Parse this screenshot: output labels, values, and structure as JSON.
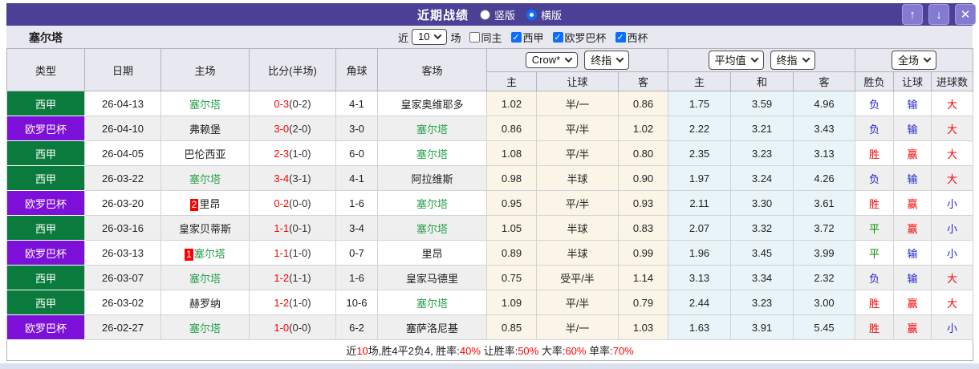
{
  "header": {
    "title": "近期战绩",
    "layout_vertical": "竖版",
    "layout_horizontal": "横版",
    "up_icon": "↑",
    "down_icon": "↓",
    "close_icon": "✕"
  },
  "filter": {
    "team": "塞尔塔",
    "near_label": "近",
    "count_value": "10",
    "games_label": "场",
    "same_home_label": "同主",
    "leagues": [
      "西甲",
      "欧罗巴杯",
      "西杯"
    ]
  },
  "table": {
    "columns": [
      "类型",
      "日期",
      "主场",
      "比分(半场)",
      "角球",
      "客场"
    ],
    "selects": {
      "company": "Crow*",
      "final1": "终指",
      "average": "平均值",
      "final2": "终指",
      "full": "全场"
    },
    "sub_headers": [
      "主",
      "让球",
      "客",
      "主",
      "和",
      "客",
      "胜负",
      "让球",
      "进球数"
    ],
    "rows": [
      {
        "league": "西甲",
        "league_color": "green",
        "date": "26-04-13",
        "home_rank": "",
        "home": "塞尔塔",
        "home_celta": true,
        "score": "0-3",
        "half": "(0-2)",
        "corner": "4-1",
        "away": "皇家奥维耶多",
        "away_celta": false,
        "crow": [
          "1.02",
          "半/一",
          "0.86"
        ],
        "avg": [
          "1.75",
          "3.59",
          "4.96"
        ],
        "results": [
          {
            "t": "负",
            "c": "blue"
          },
          {
            "t": "输",
            "c": "blue"
          },
          {
            "t": "大",
            "c": "red"
          }
        ]
      },
      {
        "league": "欧罗巴杯",
        "league_color": "purple",
        "date": "26-04-10",
        "home_rank": "",
        "home": "弗赖堡",
        "home_celta": false,
        "score": "3-0",
        "half": "(2-0)",
        "corner": "3-0",
        "away": "塞尔塔",
        "away_celta": true,
        "crow": [
          "0.86",
          "平/半",
          "1.02"
        ],
        "avg": [
          "2.22",
          "3.21",
          "3.43"
        ],
        "results": [
          {
            "t": "负",
            "c": "blue"
          },
          {
            "t": "输",
            "c": "blue"
          },
          {
            "t": "大",
            "c": "red"
          }
        ]
      },
      {
        "league": "西甲",
        "league_color": "green",
        "date": "26-04-05",
        "home_rank": "",
        "home": "巴伦西亚",
        "home_celta": false,
        "score": "2-3",
        "half": "(1-0)",
        "corner": "6-0",
        "away": "塞尔塔",
        "away_celta": true,
        "crow": [
          "1.08",
          "平/半",
          "0.80"
        ],
        "avg": [
          "2.35",
          "3.23",
          "3.13"
        ],
        "results": [
          {
            "t": "胜",
            "c": "red"
          },
          {
            "t": "赢",
            "c": "red"
          },
          {
            "t": "大",
            "c": "red"
          }
        ]
      },
      {
        "league": "西甲",
        "league_color": "green",
        "date": "26-03-22",
        "home_rank": "",
        "home": "塞尔塔",
        "home_celta": true,
        "score": "3-4",
        "half": "(3-1)",
        "corner": "4-1",
        "away": "阿拉维斯",
        "away_celta": false,
        "crow": [
          "0.98",
          "半球",
          "0.90"
        ],
        "avg": [
          "1.97",
          "3.24",
          "4.26"
        ],
        "results": [
          {
            "t": "负",
            "c": "blue"
          },
          {
            "t": "输",
            "c": "blue"
          },
          {
            "t": "大",
            "c": "red"
          }
        ]
      },
      {
        "league": "欧罗巴杯",
        "league_color": "purple",
        "date": "26-03-20",
        "home_rank": "2",
        "home": "里昂",
        "home_celta": false,
        "score": "0-2",
        "half": "(0-0)",
        "corner": "1-6",
        "away": "塞尔塔",
        "away_celta": true,
        "crow": [
          "0.95",
          "平/半",
          "0.93"
        ],
        "avg": [
          "2.11",
          "3.30",
          "3.61"
        ],
        "results": [
          {
            "t": "胜",
            "c": "red"
          },
          {
            "t": "赢",
            "c": "red"
          },
          {
            "t": "小",
            "c": "blue"
          }
        ]
      },
      {
        "league": "西甲",
        "league_color": "green",
        "date": "26-03-16",
        "home_rank": "",
        "home": "皇家贝蒂斯",
        "home_celta": false,
        "score": "1-1",
        "half": "(0-1)",
        "corner": "3-4",
        "away": "塞尔塔",
        "away_celta": true,
        "crow": [
          "1.05",
          "半球",
          "0.83"
        ],
        "avg": [
          "2.07",
          "3.32",
          "3.72"
        ],
        "results": [
          {
            "t": "平",
            "c": "green"
          },
          {
            "t": "赢",
            "c": "red"
          },
          {
            "t": "小",
            "c": "blue"
          }
        ]
      },
      {
        "league": "欧罗巴杯",
        "league_color": "purple",
        "date": "26-03-13",
        "home_rank": "1",
        "home": "塞尔塔",
        "home_celta": true,
        "score": "1-1",
        "half": "(1-0)",
        "corner": "0-7",
        "away": "里昂",
        "away_celta": false,
        "crow": [
          "0.89",
          "半球",
          "0.99"
        ],
        "avg": [
          "1.96",
          "3.45",
          "3.99"
        ],
        "results": [
          {
            "t": "平",
            "c": "green"
          },
          {
            "t": "输",
            "c": "blue"
          },
          {
            "t": "小",
            "c": "blue"
          }
        ]
      },
      {
        "league": "西甲",
        "league_color": "green",
        "date": "26-03-07",
        "home_rank": "",
        "home": "塞尔塔",
        "home_celta": true,
        "score": "1-2",
        "half": "(1-1)",
        "corner": "1-6",
        "away": "皇家马德里",
        "away_celta": false,
        "crow": [
          "0.75",
          "受平/半",
          "1.14"
        ],
        "avg": [
          "3.13",
          "3.34",
          "2.32"
        ],
        "results": [
          {
            "t": "负",
            "c": "blue"
          },
          {
            "t": "输",
            "c": "blue"
          },
          {
            "t": "大",
            "c": "red"
          }
        ]
      },
      {
        "league": "西甲",
        "league_color": "green",
        "date": "26-03-02",
        "home_rank": "",
        "home": "赫罗纳",
        "home_celta": false,
        "score": "1-2",
        "half": "(1-0)",
        "corner": "10-6",
        "away": "塞尔塔",
        "away_celta": true,
        "crow": [
          "1.09",
          "平/半",
          "0.79"
        ],
        "avg": [
          "2.44",
          "3.23",
          "3.00"
        ],
        "results": [
          {
            "t": "胜",
            "c": "red"
          },
          {
            "t": "赢",
            "c": "red"
          },
          {
            "t": "大",
            "c": "red"
          }
        ]
      },
      {
        "league": "欧罗巴杯",
        "league_color": "purple",
        "date": "26-02-27",
        "home_rank": "",
        "home": "塞尔塔",
        "home_celta": true,
        "score": "1-0",
        "half": "(0-0)",
        "corner": "6-2",
        "away": "塞萨洛尼基",
        "away_celta": false,
        "crow": [
          "0.85",
          "半/一",
          "1.03"
        ],
        "avg": [
          "1.63",
          "3.91",
          "5.45"
        ],
        "results": [
          {
            "t": "胜",
            "c": "red"
          },
          {
            "t": "赢",
            "c": "red"
          },
          {
            "t": "小",
            "c": "blue"
          }
        ]
      }
    ]
  },
  "footer": {
    "parts": [
      {
        "text": "近",
        "red": false
      },
      {
        "text": "10",
        "red": true
      },
      {
        "text": "场,胜4平2负4, 胜率:",
        "red": false
      },
      {
        "text": "40%",
        "red": true
      },
      {
        "text": " 让胜率:",
        "red": false
      },
      {
        "text": "50%",
        "red": true
      },
      {
        "text": " 大率:",
        "red": false
      },
      {
        "text": "60%",
        "red": true
      },
      {
        "text": " 单率:",
        "red": false
      },
      {
        "text": "70%",
        "red": true
      }
    ]
  },
  "colors": {
    "bar_purple": "#4a4096",
    "league_green": "#0a7b3c",
    "league_purple": "#7c10d8",
    "celta_green": "#2ba24c",
    "win_red": "#fe0000",
    "loss_blue": "#2323cf",
    "draw_green": "#019001"
  }
}
